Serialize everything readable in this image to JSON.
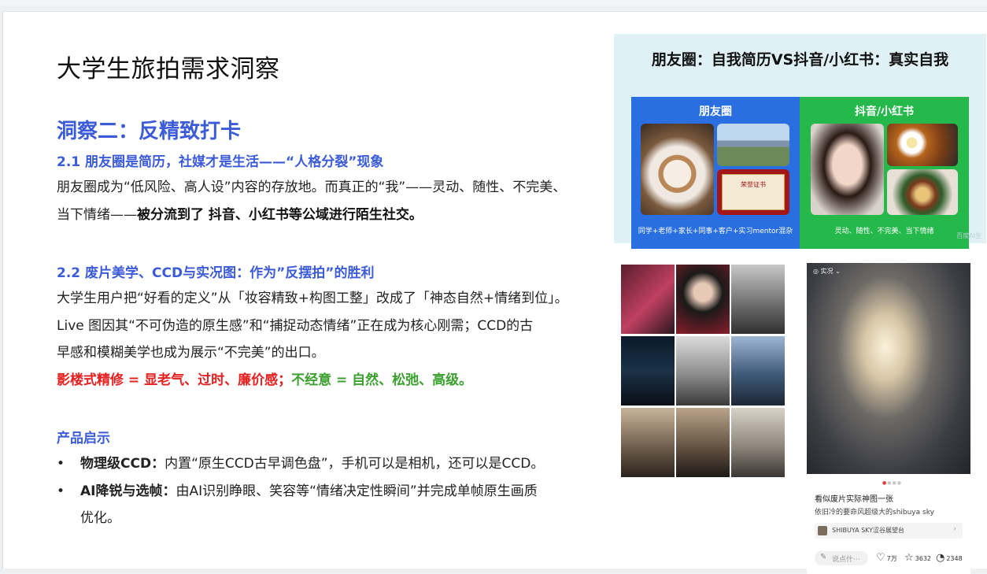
{
  "title": "大学生旅拍需求洞察",
  "insight": {
    "heading": "洞察二：反精致打卡",
    "s1_title": "2.1 朋友圈是简历，社媒才是生活——“人格分裂”现象",
    "s1_line1": "朋友圈成为“低风险、高人设”内容的存放地。而真正的“我”——灵动、随性、不完美、",
    "s1_line2_a": "当下情绪——",
    "s1_line2_b": "被分流到了 抖音、小红书等公域进行陌生社交。",
    "s2_title": "2.2 废片美学、CCD与实况图：作为”反摆拍”的胜利",
    "s2_line1": "大学生用户把“好看的定义”从「妆容精致+构图工整」改成了「神态自然+情绪到位」。",
    "s2_line2": "Live 图因其“不可伪造的原生感”和“捕捉动态情绪”正在成为核心刚需；CCD的古",
    "s2_line3": "早感和模糊美学也成为展示“不完美”的出口。",
    "s2_red": "影楼式精修 = 显老气、过时、廉价感；",
    "s2_green": "不经意 = 自然、松弛、高级。"
  },
  "product": {
    "heading": "产品启示",
    "bullet_glyph": "•",
    "b1_bold": "物理级CCD：",
    "b1_text": "内置“原生CCD古早调色盘”，手机可以是相机，还可以是CCD。",
    "b2_bold": "AI降锐与选帧：",
    "b2_text_1": "由AI识别睁眼、笑容等“情绪决定性瞬间”并完成单帧原生画质",
    "b2_text_2": "优化。"
  },
  "compare_image": {
    "title": "朋友圈：自我简历VS抖音/小红书：真实自我",
    "left_head": "朋友圈",
    "left_foot": "同学+老师+家长+同事+客户+实习mentor混杂",
    "right_head": "抖音/小红书",
    "right_foot": "灵动、随性、不完美、当下情绪",
    "certificate_text": "荣誉证书",
    "watermark": "百度AI生",
    "colors": {
      "left": "#2a6fe2",
      "right": "#25b84b",
      "bg": "#dff1f5"
    }
  },
  "phone_post": {
    "live_label": "◎ 实况 ⌄",
    "caption_title": "看似废片实际神图一张",
    "caption_sub": "依旧冷的要命风超级大的shibuya sky",
    "location": "SHIBUYA SKY涩谷展望台",
    "location_arrow": "›",
    "comment_placeholder": "说点什···",
    "likes": "7万",
    "stars": "3632",
    "comments": "2348",
    "icons": [
      "pencil-icon",
      "heart-icon",
      "star-icon",
      "comment-icon"
    ]
  }
}
